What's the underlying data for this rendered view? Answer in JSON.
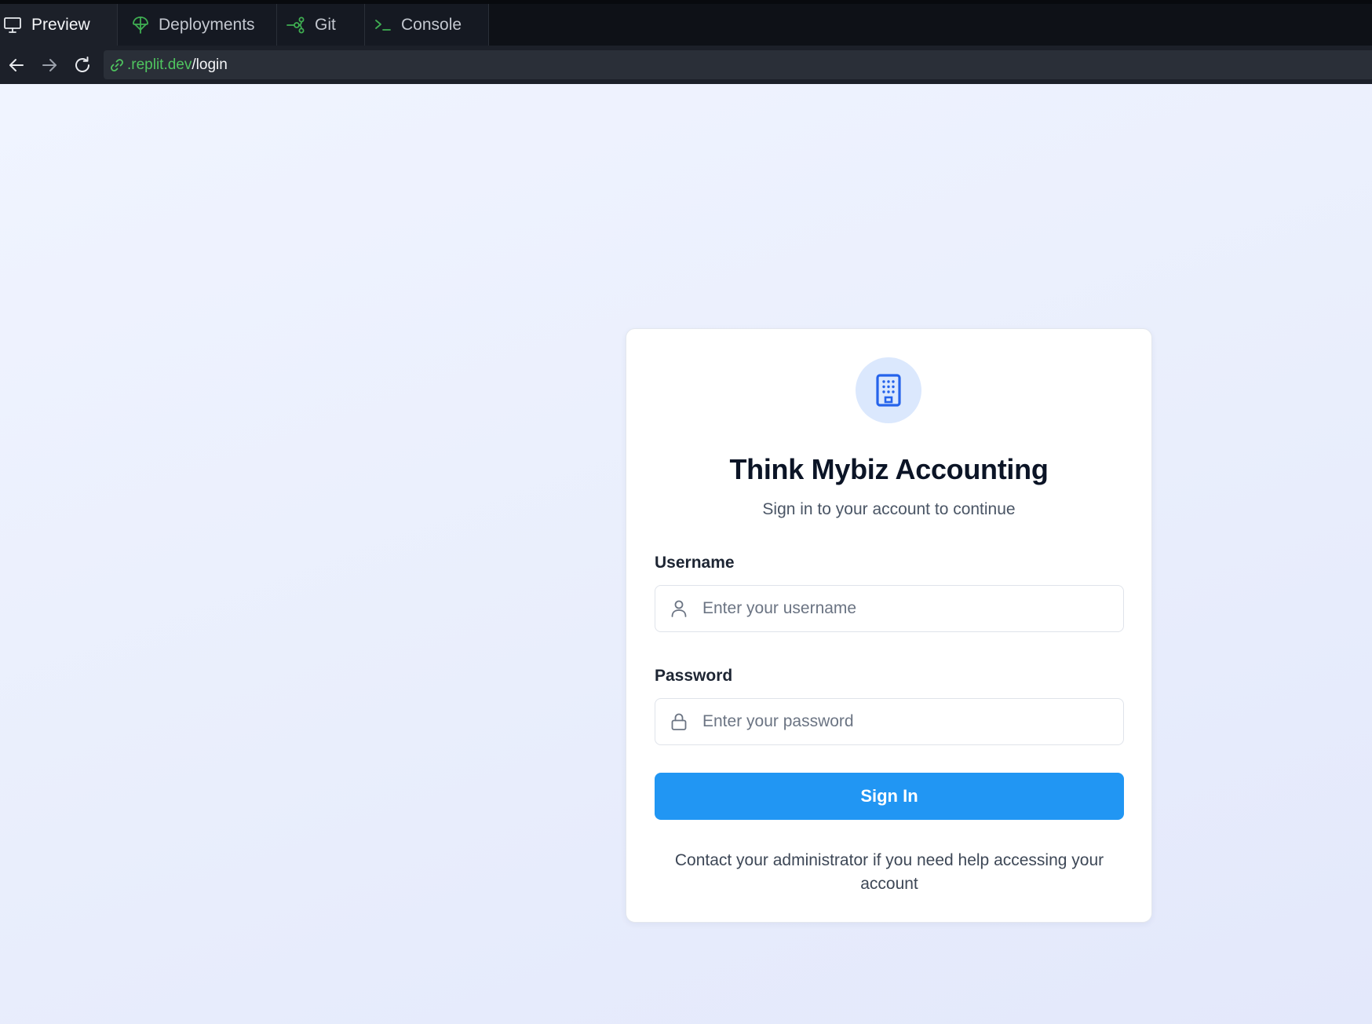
{
  "tabs": [
    {
      "label": "Preview",
      "icon": "monitor-icon",
      "active": true
    },
    {
      "label": "Deployments",
      "icon": "deployments-icon",
      "active": false
    },
    {
      "label": "Git",
      "icon": "git-branch-icon",
      "active": false
    },
    {
      "label": "Console",
      "icon": "terminal-icon",
      "active": false
    }
  ],
  "address_bar": {
    "domain": ".replit.dev",
    "path": "/login"
  },
  "login": {
    "logo_icon": "building-icon",
    "title": "Think Mybiz Accounting",
    "subtitle": "Sign in to your account to continue",
    "username_label": "Username",
    "username_placeholder": "Enter your username",
    "username_value": "",
    "password_label": "Password",
    "password_placeholder": "Enter your password",
    "password_value": "",
    "signin_label": "Sign In",
    "help_text": "Contact your administrator if you need help accessing your account"
  },
  "colors": {
    "accent": "#2196f3",
    "url_domain": "#4fc45f",
    "logo_bg": "#dbe8fd",
    "logo_fg": "#2563eb"
  }
}
